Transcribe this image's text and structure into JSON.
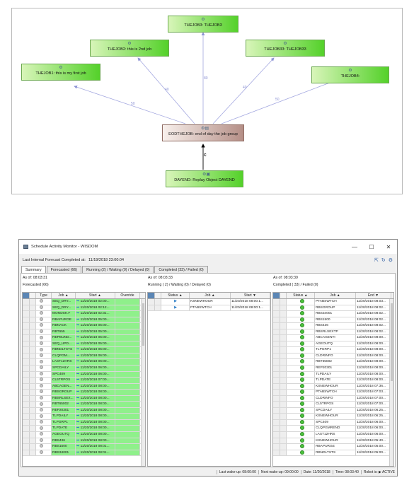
{
  "diagram": {
    "nodes": [
      {
        "id": "job3",
        "label": "THEJOB3: THEJOB3"
      },
      {
        "id": "job2",
        "label": "THEJOB2: this is 2nd job"
      },
      {
        "id": "job33",
        "label": "THEJOB33: THEJOB33"
      },
      {
        "id": "job1",
        "label": "THEJOB1: this is my first job"
      },
      {
        "id": "job4",
        "label": "THEJOB4:"
      },
      {
        "id": "eod",
        "label": "EODTHEJOB: end of day the job group"
      },
      {
        "id": "dayend",
        "label": "DAYEND: Replay Object DAYEND"
      }
    ],
    "edge_labels": [
      "80",
      "40",
      "40",
      "50",
      "50",
      "C"
    ]
  },
  "window": {
    "title": "Schedule Activity Monitor - WISDOM",
    "controls": [
      "—",
      "☐",
      "✕"
    ],
    "forecast_label": "Last Internal Forecast Completed at:",
    "forecast_value": "11/19/2018 23:00:04",
    "tabs": [
      "Summary",
      "Forecasted (66)",
      "Running (2) / Waiting (0) / Delayed (0)",
      "Completed (33) / Failed (0)"
    ],
    "left": {
      "asof": "As of:  08:03:31",
      "label": "Forecasted (66)",
      "headers": [
        "Type",
        "Job ▲",
        "Start ▲",
        "Override"
      ],
      "rows": [
        [
          "SEQ_DRY...",
          "11/20/2018 02:00..."
        ],
        [
          "SEQ_DRY...",
          "11/20/2018 02:12..."
        ],
        [
          "MONDSK.F",
          "11/20/2018 02:31..."
        ],
        [
          "RBAPURGE",
          "11/20/2018 05:00..."
        ],
        [
          "RBNACK",
          "11/20/2018 05:00..."
        ],
        [
          "RBT655",
          "11/20/2018 05:00..."
        ],
        [
          "REPBUND...",
          "11/20/2018 05:00..."
        ],
        [
          "SEQ_UPD...",
          "11/20/2018 05:00..."
        ],
        [
          "RBNDLTSTS",
          "11/20/2018 05:00..."
        ],
        [
          "CLQPGM...",
          "11/20/2018 06:00..."
        ],
        [
          "LAST12HRS",
          "11/20/2018 06:00..."
        ],
        [
          "SPCDAILY",
          "11/20/2018 06:00..."
        ],
        [
          "SPC409",
          "11/20/2018 06:00..."
        ],
        [
          "CL5TRPOS",
          "11/20/2018 07:00..."
        ],
        [
          "ABCAGEN...",
          "11/20/2018 08:00..."
        ],
        [
          "RBSGROUP",
          "11/20/2018 08:00..."
        ],
        [
          "RBSRLSEX...",
          "11/20/2018 08:00..."
        ],
        [
          "RBT65002",
          "11/20/2018 08:00..."
        ],
        [
          "REP20301",
          "11/20/2018 08:00..."
        ],
        [
          "TLPDAILY",
          "11/20/2018 08:00..."
        ],
        [
          "TLPGRP1",
          "11/20/2018 08:00..."
        ],
        [
          "TLPDATE",
          "11/20/2018 08:00..."
        ],
        [
          "AGEOUTQ",
          "11/20/2018 08:00..."
        ],
        [
          "RBS436",
          "11/20/2018 08:00..."
        ],
        [
          "RBS1500",
          "11/20/2018 08:01..."
        ],
        [
          "RBS34001",
          "11/20/2018 08:01..."
        ]
      ]
    },
    "middle": {
      "asof": "As of:  08:03:33",
      "label": "Running ( 2) / Waiting (0) / Delayed (0)",
      "headers": [
        "Status ▲",
        "Job ▲",
        "Start ▼"
      ],
      "rows": [
        [
          "KSNEWHOUR",
          "11/20/2018 08:00:1..."
        ],
        [
          "PTABSWTCH",
          "11/20/2018 08:00:1..."
        ]
      ]
    },
    "right": {
      "asof": "As of:  08:03:39",
      "label": "Completed ( 33) / Failed (0)",
      "headers": [
        "Status ▲",
        "Job ▲",
        "End ▼"
      ],
      "rows": [
        [
          "PTABSWTCH",
          "11/20/2018 08:03..."
        ],
        [
          "RBSGROUP",
          "11/20/2018 08:02..."
        ],
        [
          "RBS34001",
          "11/20/2018 08:02..."
        ],
        [
          "RBS1500",
          "11/20/2018 08:02..."
        ],
        [
          "RBS436",
          "11/20/2018 08:02..."
        ],
        [
          "RBSRLSEXTP",
          "11/20/2018 08:02..."
        ],
        [
          "ABCAGENTI",
          "11/20/2018 08:00..."
        ],
        [
          "AGEOUTQ",
          "11/20/2018 08:00..."
        ],
        [
          "TLPGRP1",
          "11/20/2018 08:00..."
        ],
        [
          "CLDRINFO",
          "11/20/2018 08:00..."
        ],
        [
          "RBT65002",
          "11/20/2018 08:00..."
        ],
        [
          "REP20301",
          "11/20/2018 08:00..."
        ],
        [
          "TLPDAILY",
          "11/20/2018 08:00..."
        ],
        [
          "TLPDATE",
          "11/20/2018 08:00..."
        ],
        [
          "KSNEWHOUR",
          "11/20/2018 07:36..."
        ],
        [
          "PTABSWTCH",
          "11/20/2018 07:03..."
        ],
        [
          "CLDRINFO",
          "11/20/2018 07:00..."
        ],
        [
          "CL5TRPOS",
          "11/20/2018 07:00..."
        ],
        [
          "SPCDAILY",
          "11/20/2018 06:25..."
        ],
        [
          "KSNEWHOUR",
          "11/20/2018 06:25..."
        ],
        [
          "SPC409",
          "11/20/2018 06:00..."
        ],
        [
          "CLQPGMREND",
          "11/20/2018 06:00..."
        ],
        [
          "LAST12HRS",
          "11/20/2018 06:00..."
        ],
        [
          "KSNEWHOUR",
          "11/20/2018 05:40..."
        ],
        [
          "RBAPURGE",
          "11/20/2018 05:00..."
        ],
        [
          "RBNDLTSTS",
          "11/20/2018 05:00..."
        ]
      ]
    },
    "status": {
      "last_wakeup": "Last wake-up: 08:00:00",
      "next_wakeup": "Next wake-up: 09:00:00",
      "date": "Date: 11/20/2018",
      "time": "Time: 08:03:40",
      "robot": "Robot is: ▶ ACTIVE"
    }
  }
}
